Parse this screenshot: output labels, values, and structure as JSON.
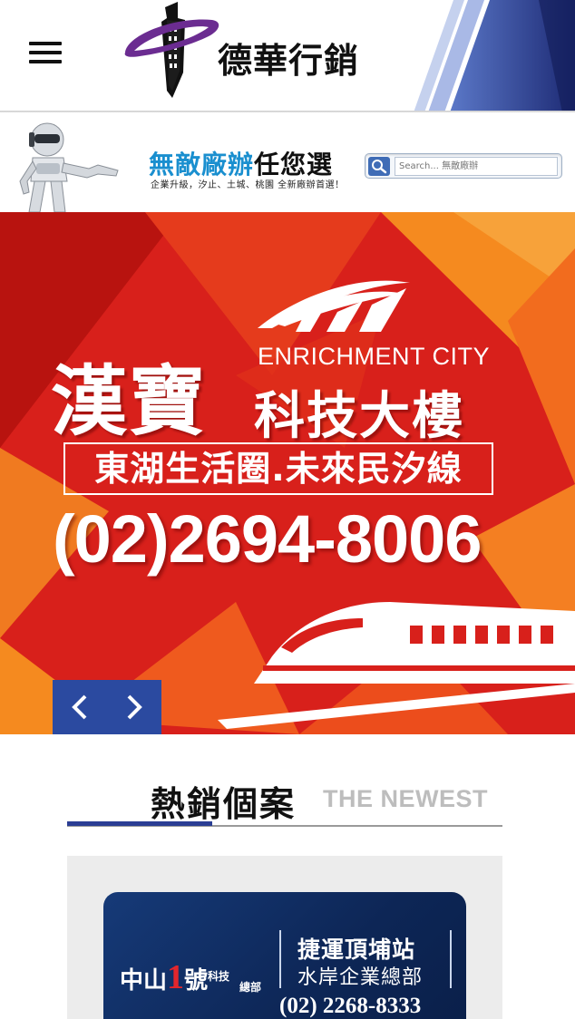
{
  "header": {
    "brand_name": "德華行銷",
    "menu_icon": "hamburger-menu-icon",
    "logo_icon": "tower-logo-icon"
  },
  "ad_strip": {
    "title_highlight": "無敵廠辦",
    "title_rest": "任您選",
    "subtitle": "企業升級，汐止、土城、桃園 全新廠辦首選！",
    "search_placeholder": "Search... 無敵廠辦",
    "search_icon": "search-icon",
    "mascot_icon": "robot-mascot-icon"
  },
  "hero": {
    "title_big": "漢寶",
    "title_en": "ENRICHMENT CITY",
    "title_sub": "科技大樓",
    "tagline": "東湖生活圈.未來民汐線",
    "phone": "(02)2694-8006",
    "prev_icon": "chevron-left-icon",
    "next_icon": "chevron-right-icon",
    "train_icon": "train-icon"
  },
  "section": {
    "title_zh": "熱銷個案",
    "title_en": "THE NEWEST"
  },
  "project_card": {
    "logo_main": "中山",
    "logo_number": "1",
    "logo_suffix": "號",
    "logo_small_top": "科技",
    "logo_small_bottom": "總部",
    "line1": "捷運頂埔站",
    "line2": "水岸企業總部",
    "phone": "(02) 2268-8333"
  },
  "colors": {
    "accent_blue": "#2b3e94",
    "hero_red": "#d8201b",
    "hero_orange": "#f58a1f"
  }
}
